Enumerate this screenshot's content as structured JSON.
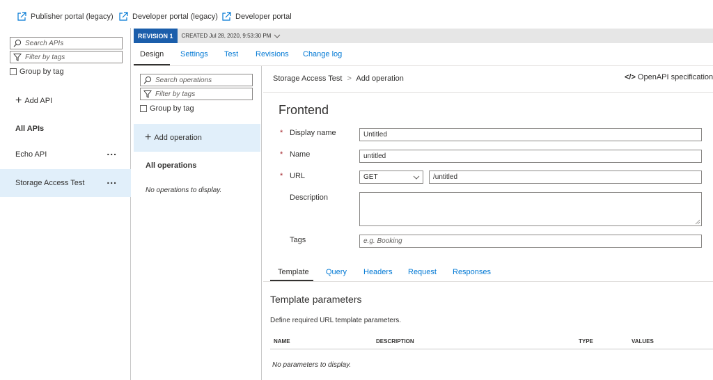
{
  "portal_links": [
    {
      "label": "Publisher portal (legacy)"
    },
    {
      "label": "Developer portal (legacy)"
    },
    {
      "label": "Developer portal"
    }
  ],
  "left_pane": {
    "search_placeholder": "Search APIs",
    "filter_placeholder": "Filter by tags",
    "group_by_tag": "Group by tag",
    "add_api": "Add API",
    "all_apis": "All APIs",
    "apis": [
      {
        "name": "Echo API",
        "more": "..."
      },
      {
        "name": "Storage Access Test",
        "more": "..."
      }
    ]
  },
  "revision": {
    "badge": "REVISION 1",
    "created": "CREATED Jul 28, 2020, 9:53:30 PM"
  },
  "tabs": [
    "Design",
    "Settings",
    "Test",
    "Revisions",
    "Change log"
  ],
  "ops_pane": {
    "search_placeholder": "Search operations",
    "filter_placeholder": "Filter by tags",
    "group_by_tag": "Group by tag",
    "add_operation": "Add operation",
    "all_operations": "All operations",
    "empty": "No operations to display."
  },
  "breadcrumb": {
    "api": "Storage Access Test",
    "separator": ">",
    "current": "Add operation"
  },
  "openapi_link": "OpenAPI specification V",
  "form": {
    "section_title": "Frontend",
    "required_mark": "*",
    "display_name_label": "Display name",
    "display_name_value": "Untitled",
    "name_label": "Name",
    "name_value": "untitled",
    "url_label": "URL",
    "method_value": "GET",
    "url_value": "/untitled",
    "description_label": "Description",
    "description_value": "",
    "tags_label": "Tags",
    "tags_placeholder": "e.g. Booking"
  },
  "sub_tabs": [
    "Template",
    "Query",
    "Headers",
    "Request",
    "Responses"
  ],
  "template": {
    "title": "Template parameters",
    "subtitle": "Define required URL template parameters.",
    "columns": [
      "NAME",
      "DESCRIPTION",
      "TYPE",
      "VALUES"
    ],
    "empty": "No parameters to display."
  },
  "colors": {
    "accent": "#0078d4",
    "revision_badge": "#1b5eab",
    "selected_bg": "#e1effa",
    "required": "#a4262c"
  }
}
